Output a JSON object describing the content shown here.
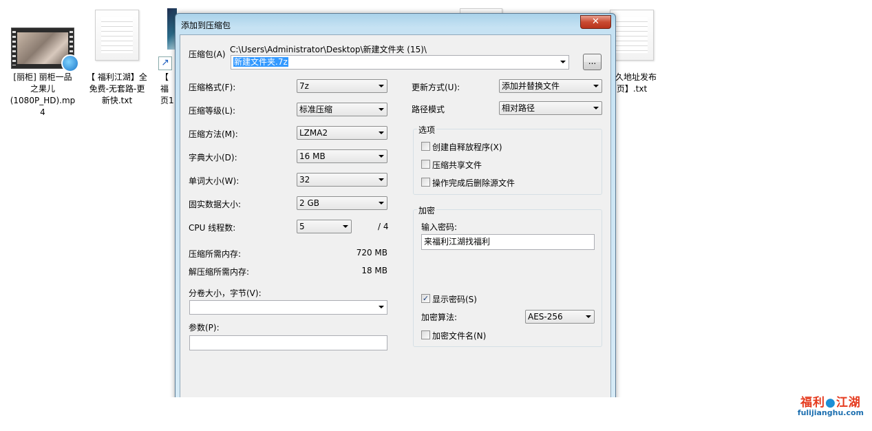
{
  "desktop": {
    "icons": [
      {
        "label": "[丽柜] 丽柜一品之果儿(1080P_HD).mp4",
        "kind": "video"
      },
      {
        "label": "【 福利江湖】全免费-无套路-更新快.txt",
        "kind": "text"
      },
      {
        "label": "【 福利江湖】网页1",
        "kind": "shortcut"
      },
      {
        "label": "永久地址发布页】.txt",
        "kind": "text"
      }
    ],
    "icon_labels": {
      "video_l1": "[丽柜] 丽柜一品",
      "video_l2": "之果儿",
      "video_l3": "(1080P_HD).mp",
      "video_l4": "4",
      "txt1_l1": "【 福利江湖】全",
      "txt1_l2": "免费-无套路-更",
      "txt1_l3": "新快.txt",
      "short_l1": "【 福",
      "short_l2": "页1",
      "txt2_l1": "永久地址发布",
      "txt2_l2": "页】.txt"
    }
  },
  "dialog": {
    "title": "添加到压缩包",
    "close_glyph": "✕",
    "archive": {
      "label": "压缩包(A)",
      "path": "C:\\Users\\Administrator\\Desktop\\新建文件夹 (15)\\",
      "filename": "新建文件夹.7z",
      "browse_label": "..."
    },
    "left": {
      "format": {
        "label": "压缩格式(F):",
        "value": "7z"
      },
      "level": {
        "label": "压缩等级(L):",
        "value": "标准压缩"
      },
      "method": {
        "label": "压缩方法(M):",
        "value": "LZMA2"
      },
      "dict": {
        "label": "字典大小(D):",
        "value": "16 MB"
      },
      "word": {
        "label": "单词大小(W):",
        "value": "32"
      },
      "solid": {
        "label": "固实数据大小:",
        "value": "2 GB"
      },
      "cpu": {
        "label": "CPU 线程数:",
        "value": "5",
        "total": "/ 4"
      },
      "mem_compress": {
        "label": "压缩所需内存:",
        "value": "720 MB"
      },
      "mem_decompress": {
        "label": "解压缩所需内存:",
        "value": "18 MB"
      },
      "volume": {
        "label": "分卷大小，字节(V):",
        "value": ""
      },
      "params": {
        "label": "参数(P):",
        "value": ""
      }
    },
    "right": {
      "update": {
        "label": "更新方式(U):",
        "value": "添加并替换文件"
      },
      "pathmode": {
        "label": "路径模式",
        "value": "相对路径"
      },
      "options": {
        "title": "选项",
        "sfx": {
          "label": "创建自释放程序(X)",
          "checked": false
        },
        "shared": {
          "label": "压缩共享文件",
          "checked": false
        },
        "delete": {
          "label": "操作完成后删除源文件",
          "checked": false
        }
      },
      "encryption": {
        "title": "加密",
        "password_label": "输入密码:",
        "password_value": "来福利江湖找福利",
        "show_password": {
          "label": "显示密码(S)",
          "checked": true,
          "mark": "✓"
        },
        "algo_label": "加密算法:",
        "algo_value": "AES-256",
        "encrypt_names": {
          "label": "加密文件名(N)",
          "checked": false
        }
      }
    }
  },
  "watermark": {
    "part1": "福利",
    "part2": "江湖",
    "site": "fulijianghu.com"
  },
  "colors": {
    "dialog_frame": "#c6e2f3",
    "client_bg": "#f0f0f0",
    "selection": "#3399ff",
    "close_button": "#c94a32",
    "watermark_red": "#e53a1e",
    "watermark_blue": "#1c8fd6"
  }
}
